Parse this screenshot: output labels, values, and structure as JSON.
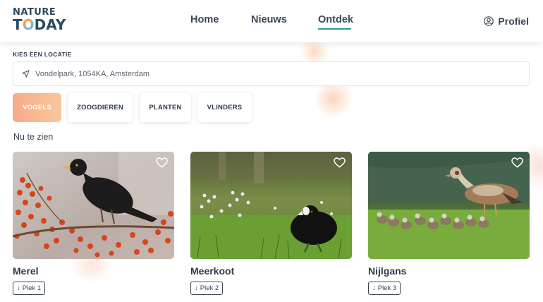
{
  "header": {
    "logo_line1": "NATURE",
    "logo_line2_pre": "T",
    "logo_line2_o": "O",
    "logo_line2_post": "DAY",
    "nav": [
      {
        "label": "Home",
        "active": false
      },
      {
        "label": "Nieuws",
        "active": false
      },
      {
        "label": "Ontdek",
        "active": true
      }
    ],
    "profile_label": "Profiel",
    "profile_icon": "user-circle-icon"
  },
  "location": {
    "label": "KIES EEN LOCATIE",
    "value": "Vondelpark, 1054KA, Amsterdam",
    "icon": "location-arrow-icon"
  },
  "categories": [
    {
      "label": "VOGELS",
      "active": true
    },
    {
      "label": "ZOOGDIEREN",
      "active": false
    },
    {
      "label": "PLANTEN",
      "active": false
    },
    {
      "label": "VLINDERS",
      "active": false
    }
  ],
  "section_title": "Nu te zien",
  "cards": [
    {
      "name": "Merel",
      "place": "Plek 1",
      "place_icon": "arrow-down-icon",
      "fav_icon": "heart-outline-icon"
    },
    {
      "name": "Meerkoot",
      "place": "Plek 2",
      "place_icon": "arrow-down-icon",
      "fav_icon": "heart-outline-icon"
    },
    {
      "name": "Nijlgans",
      "place": "Plek 3",
      "place_icon": "arrow-down-icon",
      "fav_icon": "heart-outline-icon"
    }
  ],
  "colors": {
    "accent": "#2b9c93",
    "chip_active_from": "#f7a98a",
    "chip_active_to": "#f9c89c",
    "text": "#2f3a4a"
  }
}
